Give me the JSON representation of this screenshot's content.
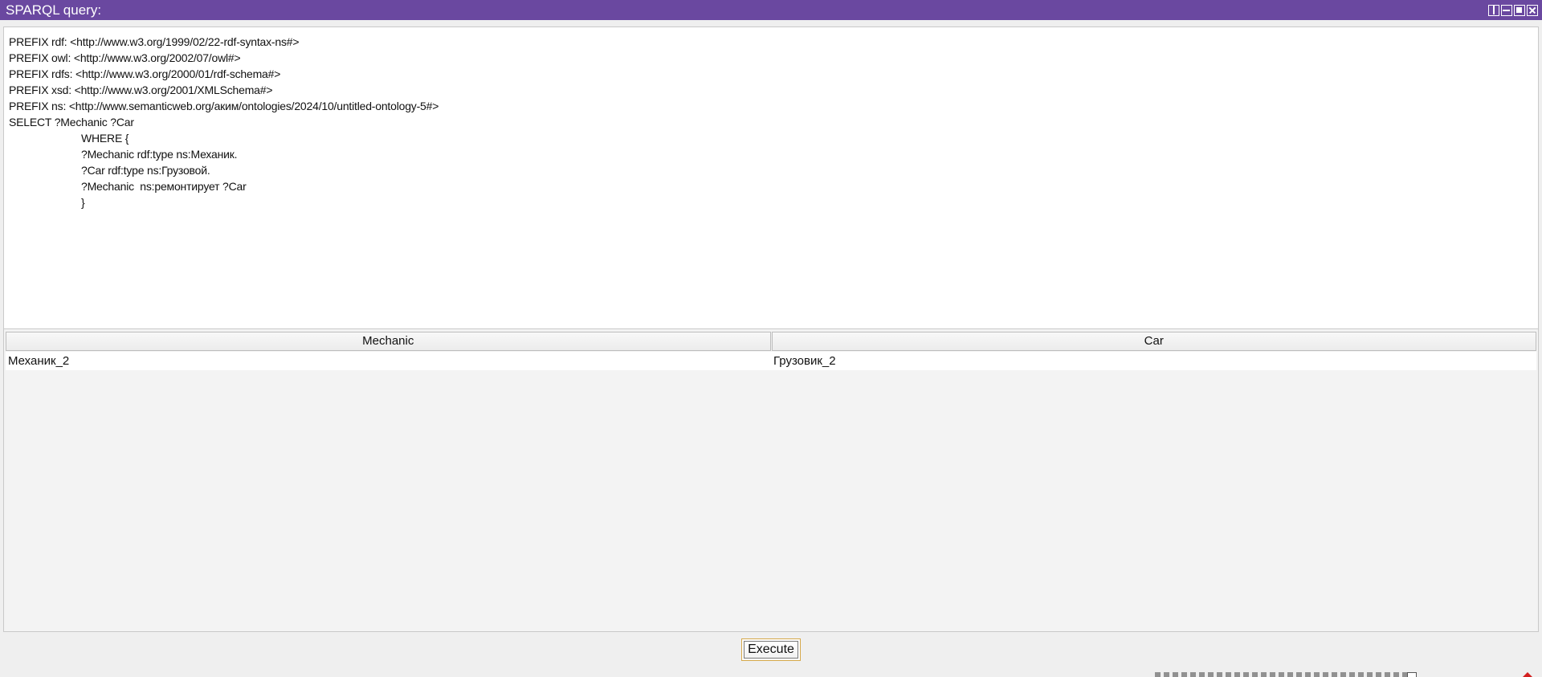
{
  "window": {
    "title": "SPARQL query:",
    "controls": [
      "split-icon",
      "minimize-icon",
      "maximize-icon",
      "close-icon"
    ]
  },
  "query": {
    "lines": [
      "PREFIX rdf: <http://www.w3.org/1999/02/22-rdf-syntax-ns#>",
      "PREFIX owl: <http://www.w3.org/2002/07/owl#>",
      "PREFIX rdfs: <http://www.w3.org/2000/01/rdf-schema#>",
      "PREFIX xsd: <http://www.w3.org/2001/XMLSchema#>",
      "PREFIX ns: <http://www.semanticweb.org/аким/ontologies/2024/10/untitled-ontology-5#>",
      "SELECT ?Mechanic ?Car",
      "WHERE {",
      "?Mechanic rdf:type ns:Механик.",
      "?Car rdf:type ns:Грузовой.",
      "?Mechanic  ns:ремонтирует ?Car",
      "}"
    ]
  },
  "results": {
    "columns": [
      "Mechanic",
      "Car"
    ],
    "rows": [
      [
        "Механик_2",
        "Грузовик_2"
      ]
    ]
  },
  "actions": {
    "execute_label": "Execute"
  },
  "colors": {
    "titlebar": "#6a48a0",
    "focus_border": "#d5a84a"
  }
}
